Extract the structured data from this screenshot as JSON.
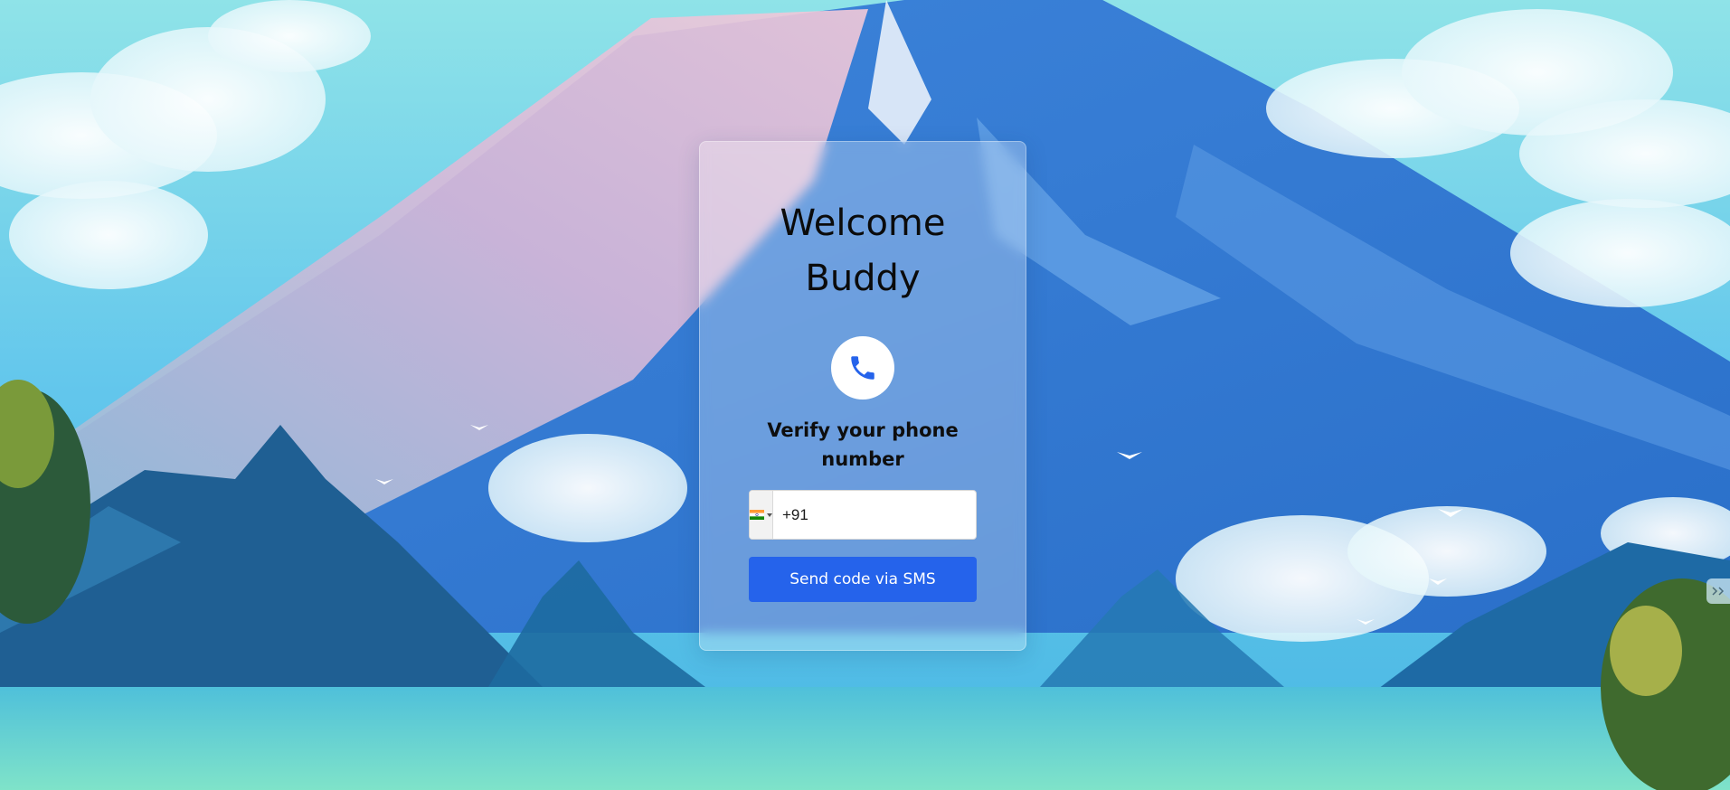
{
  "login": {
    "title_line1": "Welcome",
    "title_line2": "Buddy",
    "verify_line1": "Verify your phone",
    "verify_line2": "number",
    "country_flag": "india-flag-icon",
    "phone_value": "+91",
    "send_button_label": "Send code via SMS"
  },
  "colors": {
    "accent": "#2563eb",
    "phone_icon": "#2563eb"
  },
  "icons": {
    "phone_badge": "phone-icon",
    "country_dropdown": "caret-down-icon",
    "side_widget": "double-chevron-icon"
  }
}
